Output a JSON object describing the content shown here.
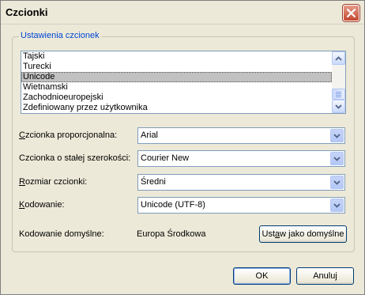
{
  "dialog": {
    "title": "Czcionki"
  },
  "group": {
    "label": "Ustawienia czcionek"
  },
  "list": {
    "items": [
      "Tajski",
      "Turecki",
      "Unicode",
      "Wietnamski",
      "Zachodnioeuropejski",
      "Zdefiniowany przez użytkownika"
    ],
    "selected_index": 2
  },
  "fields": {
    "proportional": {
      "label_pre": "",
      "label_ul": "C",
      "label_post": "zcionka proporcjonalna:",
      "value": "Arial"
    },
    "fixed": {
      "label_pre": "Czcionka o stałej szerokości",
      "label_ul": "",
      "label_post": ":",
      "value": "Courier New"
    },
    "size": {
      "label_pre": "",
      "label_ul": "R",
      "label_post": "ozmiar czcionki:",
      "value": "Średni"
    },
    "encoding": {
      "label_pre": "",
      "label_ul": "K",
      "label_post": "odowanie:",
      "value": "Unicode (UTF-8)"
    }
  },
  "default_encoding": {
    "label": "Kodowanie domyślne:",
    "value": "Europa Środkowa",
    "button_pre": "Ust",
    "button_ul": "a",
    "button_post": "w jako domyślne"
  },
  "buttons": {
    "ok": "OK",
    "cancel": "Anuluj"
  },
  "icons": {
    "close": "close-icon",
    "scroll_up": "chevron-up-icon",
    "scroll_down": "chevron-down-icon",
    "combo_arrow": "chevron-down-icon"
  }
}
